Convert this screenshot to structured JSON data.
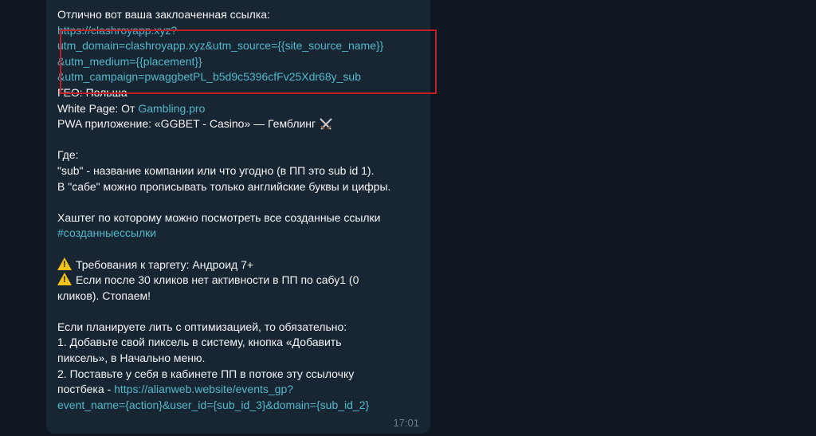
{
  "message": {
    "intro": "Отлично вот ваша заклоаченная ссылка:",
    "link_lines": [
      "https://clashroyapp.xyz?",
      "utm_domain=clashroyapp.xyz&utm_source={{site_source_name}}",
      "&utm_medium={{placement}}",
      "&utm_campaign=pwaggbetPL_b5d9c5396cfFv25Xdr68y_sub"
    ],
    "geo": "ГЕО: Польша",
    "white_page_prefix": "White Page: От ",
    "white_page_link": "Gambling.pro",
    "pwa": "PWA приложение: «GGBET - Casino» — Гемблинг",
    "where_title": "Где:",
    "where_1": "\"sub\" -  название компании или что угодно (в ПП это sub id 1).",
    "where_2": "В \"сабе\" можно прописывать только английские буквы и цифры.",
    "hashtag_text": "Хаштег по которому можно посмотреть все созданные ссылки",
    "hashtag": "#созданныессылки",
    "req_1": "Требования к таргету: Андроид 7+",
    "req_2a": "Если после 30 кликов нет активности в ПП по сабу1 (0",
    "req_2b": "кликов). Стопаем!",
    "opt_title": "Если планируете лить с оптимизацией, то обязательно:",
    "opt_1a": "1. Добавьте свой пиксель в систему, кнопка «Добавить",
    "opt_1b": "пиксель», в Начально меню.",
    "opt_2a": "2. Поставьте у себя в кабинете ПП в потоке эту ссылочку",
    "opt_2b_prefix": "постбека - ",
    "opt_2b_link": "https://alianweb.website/events_gp?",
    "opt_2c_link": "event_name={action}&user_id={sub_id_3}&domain={sub_id_2}",
    "time": "17:01"
  },
  "colors": {
    "background": "#0e1621",
    "bubble": "#182533",
    "text": "#f5f5f5",
    "link": "#52b9c8",
    "highlight_border": "#c21e24",
    "warning": "#f2c318"
  }
}
